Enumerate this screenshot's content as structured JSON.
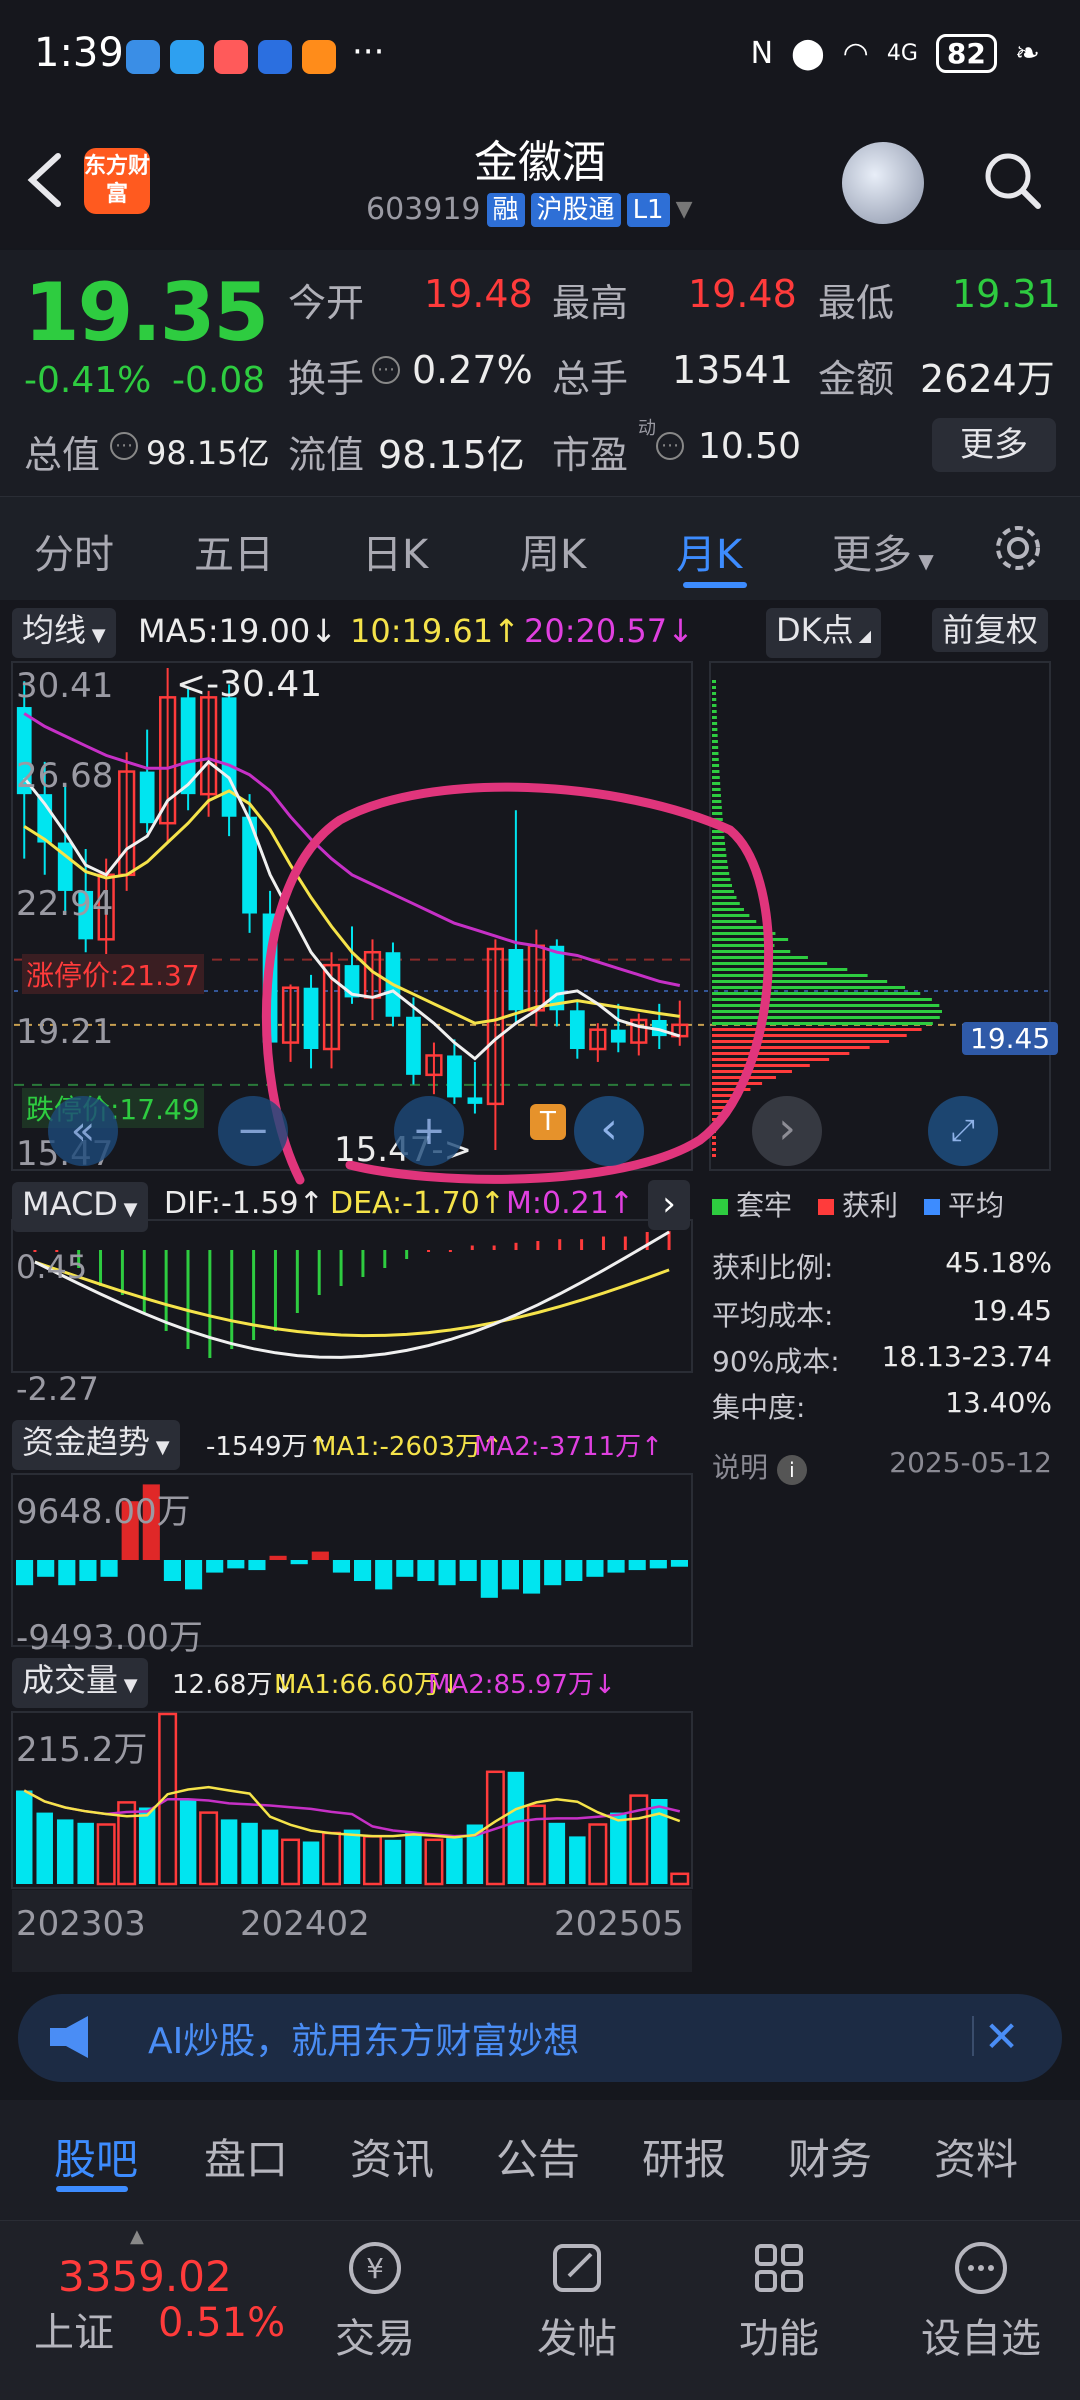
{
  "status": {
    "time": "1:39",
    "dots": "···",
    "network": "4G",
    "battery": "82"
  },
  "header": {
    "title": "金徽酒",
    "code": "603919",
    "tags": [
      "融",
      "沪股通",
      "L1"
    ],
    "logo": "东方财富"
  },
  "quote": {
    "price": "19.35",
    "change_pct": "-0.41%",
    "change_abs": "-0.08",
    "open_label": "今开",
    "open": "19.48",
    "high_label": "最高",
    "high": "19.48",
    "low_label": "最低",
    "low": "19.31",
    "turnover_label": "换手",
    "turnover": "0.27%",
    "volume_label": "总手",
    "volume": "13541",
    "amount_label": "金额",
    "amount": "2624万",
    "mktcap_label": "总值",
    "mktcap": "98.15亿",
    "float_label": "流值",
    "float": "98.15亿",
    "pe_label": "市盈",
    "pe_sup": "动",
    "pe": "10.50",
    "more": "更多"
  },
  "tabs": [
    "分时",
    "五日",
    "日K",
    "周K",
    "月K",
    "更多"
  ],
  "chart": {
    "ma_chip": "均线",
    "ma5": "MA5:19.00↓",
    "ma10": "10:19.61↑",
    "ma20": "20:20.57↓",
    "dk": "DK点",
    "fq": "前复权",
    "y_labels": [
      "30.41",
      "26.68",
      "22.94",
      "19.21",
      "15.47"
    ],
    "high_mark": "<-30.41",
    "low_mark": "15.47->",
    "limit_up": "涨停价:21.37",
    "limit_down": "跌停价:17.49",
    "chip_price": "19.45",
    "t_marker": "T"
  },
  "chart_data": {
    "type": "candlestick",
    "x_labels": [
      "202303",
      "202402",
      "202505"
    ],
    "ylim": [
      15.47,
      30.41
    ],
    "candles": [
      {
        "o": 29.2,
        "h": 30.0,
        "l": 24.5,
        "c": 26.5
      },
      {
        "o": 26.5,
        "h": 27.5,
        "l": 24.0,
        "c": 25.0
      },
      {
        "o": 25.0,
        "h": 26.8,
        "l": 22.8,
        "c": 23.5
      },
      {
        "o": 23.5,
        "h": 24.8,
        "l": 21.6,
        "c": 22.0
      },
      {
        "o": 22.0,
        "h": 24.5,
        "l": 21.2,
        "c": 24.0
      },
      {
        "o": 24.0,
        "h": 27.8,
        "l": 23.5,
        "c": 27.2
      },
      {
        "o": 27.2,
        "h": 28.5,
        "l": 25.3,
        "c": 25.6
      },
      {
        "o": 25.6,
        "h": 30.41,
        "l": 25.0,
        "c": 29.5
      },
      {
        "o": 29.5,
        "h": 29.8,
        "l": 26.0,
        "c": 26.5
      },
      {
        "o": 26.5,
        "h": 29.7,
        "l": 25.8,
        "c": 29.5
      },
      {
        "o": 29.5,
        "h": 29.9,
        "l": 25.2,
        "c": 25.8
      },
      {
        "o": 25.8,
        "h": 26.5,
        "l": 22.2,
        "c": 22.8
      },
      {
        "o": 22.8,
        "h": 23.5,
        "l": 18.2,
        "c": 18.8
      },
      {
        "o": 18.8,
        "h": 20.6,
        "l": 18.2,
        "c": 20.5
      },
      {
        "o": 20.5,
        "h": 20.9,
        "l": 18.0,
        "c": 18.6
      },
      {
        "o": 18.6,
        "h": 21.6,
        "l": 18.0,
        "c": 21.2
      },
      {
        "o": 21.2,
        "h": 22.4,
        "l": 20.0,
        "c": 20.2
      },
      {
        "o": 20.2,
        "h": 22.0,
        "l": 19.5,
        "c": 21.6
      },
      {
        "o": 21.6,
        "h": 21.9,
        "l": 19.3,
        "c": 19.6
      },
      {
        "o": 19.6,
        "h": 20.2,
        "l": 17.5,
        "c": 17.8
      },
      {
        "o": 17.8,
        "h": 18.8,
        "l": 17.2,
        "c": 18.4
      },
      {
        "o": 18.4,
        "h": 18.9,
        "l": 16.9,
        "c": 17.1
      },
      {
        "o": 17.1,
        "h": 18.2,
        "l": 16.6,
        "c": 16.9
      },
      {
        "o": 16.9,
        "h": 22.0,
        "l": 15.47,
        "c": 21.7
      },
      {
        "o": 21.7,
        "h": 26.0,
        "l": 19.4,
        "c": 19.8
      },
      {
        "o": 19.8,
        "h": 22.3,
        "l": 19.3,
        "c": 21.8
      },
      {
        "o": 21.8,
        "h": 22.0,
        "l": 19.3,
        "c": 19.8
      },
      {
        "o": 19.8,
        "h": 20.1,
        "l": 18.3,
        "c": 18.6
      },
      {
        "o": 18.6,
        "h": 19.4,
        "l": 18.2,
        "c": 19.2
      },
      {
        "o": 19.2,
        "h": 20.0,
        "l": 18.5,
        "c": 18.8
      },
      {
        "o": 18.8,
        "h": 19.7,
        "l": 18.4,
        "c": 19.5
      },
      {
        "o": 19.5,
        "h": 20.0,
        "l": 18.6,
        "c": 19.0
      },
      {
        "o": 19.0,
        "h": 20.1,
        "l": 18.7,
        "c": 19.35
      }
    ],
    "ma_white": [
      27.0,
      26.2,
      25.3,
      24.3,
      24.0,
      24.8,
      25.2,
      26.3,
      26.8,
      27.5,
      27.0,
      25.7,
      24.0,
      22.8,
      21.6,
      20.8,
      20.3,
      20.2,
      20.4,
      19.9,
      19.4,
      18.8,
      18.3,
      18.9,
      19.4,
      19.8,
      20.3,
      20.4,
      20.0,
      19.5,
      19.3,
      19.2,
      19.0
    ],
    "ma_yellow": [
      25.5,
      25.1,
      24.6,
      24.1,
      23.9,
      24.0,
      24.4,
      25.0,
      25.6,
      26.3,
      26.6,
      26.2,
      25.4,
      24.3,
      23.3,
      22.4,
      21.6,
      21.0,
      20.6,
      20.3,
      20.0,
      19.7,
      19.4,
      19.5,
      19.7,
      19.9,
      20.0,
      20.1,
      20.0,
      19.9,
      19.8,
      19.7,
      19.61
    ],
    "ma_magenta": [
      29.0,
      28.6,
      28.3,
      28.0,
      27.7,
      27.5,
      27.3,
      27.3,
      27.5,
      27.6,
      27.4,
      27.1,
      26.6,
      25.8,
      25.1,
      24.5,
      24.0,
      23.7,
      23.4,
      23.1,
      22.8,
      22.5,
      22.3,
      22.1,
      21.9,
      21.8,
      21.6,
      21.5,
      21.3,
      21.1,
      20.9,
      20.7,
      20.57
    ],
    "chip_profile_note": "chip distribution histogram on right side"
  },
  "macd": {
    "chip": "MACD",
    "dif": "DIF:-1.59↑",
    "dea": "DEA:-1.70↑",
    "m": "M:0.21↑",
    "y_top": "0.45",
    "y_bottom": "-2.27",
    "hist": [
      0,
      0,
      -0.2,
      -0.4,
      -0.5,
      -0.7,
      -0.9,
      -1.1,
      -1.2,
      -1.1,
      -1.0,
      -0.9,
      -0.7,
      -0.5,
      -0.4,
      -0.3,
      -0.2,
      -0.1,
      0,
      0,
      0.05,
      0.05,
      0.08,
      0.1,
      0.12,
      0.12,
      0.15,
      0.15,
      0.2,
      0.21
    ]
  },
  "fund": {
    "chip": "资金趋势",
    "v": "-1549万↑",
    "ma1": "MA1:-2603万↑",
    "ma2": "MA2:-3711万↑",
    "y_top": "9648.00万",
    "y_bottom": "-9493.00万",
    "bars": [
      -0.3,
      -0.2,
      -0.3,
      -0.25,
      -0.2,
      0.7,
      0.9,
      -0.25,
      -0.35,
      -0.15,
      -0.1,
      -0.12,
      0.05,
      -0.05,
      0.1,
      -0.15,
      -0.25,
      -0.35,
      -0.2,
      -0.25,
      -0.3,
      -0.25,
      -0.45,
      -0.35,
      -0.4,
      -0.3,
      -0.25,
      -0.2,
      -0.15,
      -0.12,
      -0.1,
      -0.08
    ]
  },
  "volume": {
    "chip": "成交量",
    "v": "12.68万↓",
    "ma1": "MA1:66.60万↓",
    "ma2": "MA2:85.97万↓",
    "y_top": "215.2万",
    "bars": [
      0.55,
      0.42,
      0.38,
      0.36,
      0.35,
      0.48,
      0.45,
      1.0,
      0.5,
      0.42,
      0.38,
      0.36,
      0.32,
      0.26,
      0.25,
      0.3,
      0.32,
      0.28,
      0.26,
      0.3,
      0.26,
      0.27,
      0.35,
      0.66,
      0.66,
      0.46,
      0.36,
      0.28,
      0.35,
      0.42,
      0.52,
      0.5,
      0.06
    ]
  },
  "chip_info": {
    "legend": [
      "套牢",
      "获利",
      "平均"
    ],
    "profit_ratio_label": "获利比例:",
    "profit_ratio": "45.18%",
    "avg_cost_label": "平均成本:",
    "avg_cost": "19.45",
    "cost90_label": "90%成本:",
    "cost90": "18.13-23.74",
    "concentration_label": "集中度:",
    "concentration": "13.40%",
    "note_label": "说明",
    "date": "2025-05-12"
  },
  "ai_banner": {
    "text": "AI炒股，就用东方财富妙想"
  },
  "bottom_tabs": [
    "股吧",
    "盘口",
    "资讯",
    "公告",
    "研报",
    "财务",
    "资料"
  ],
  "bottom_nav": {
    "index_value": "3359.02",
    "index_name": "上证",
    "index_change": "0.51%",
    "items": [
      "交易",
      "发帖",
      "功能",
      "设自选"
    ]
  },
  "colors": {
    "up": "#ff3b3b",
    "down": "#2ecc40",
    "accent": "#3d8cff",
    "cyan": "#00e5f0",
    "annotation": "#e0357c"
  }
}
